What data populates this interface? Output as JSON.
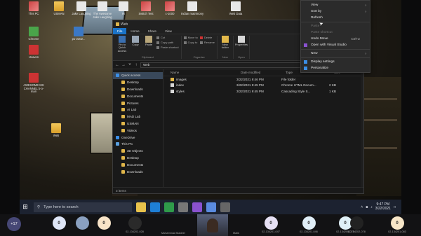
{
  "desktop": {
    "icons": [
      {
        "label": "This PC",
        "kind": "app"
      },
      {
        "label": "USMAN",
        "kind": "folder"
      },
      {
        "label": "Jake Laughing",
        "kind": "doc"
      },
      {
        "label": "The Awesome Jake Laughing",
        "kind": "doc"
      },
      {
        "label": "Hi",
        "kind": "doc"
      },
      {
        "label": "Switch Test",
        "kind": "app"
      },
      {
        "label": "c-1000",
        "kind": "app"
      },
      {
        "label": "Indian matrimony",
        "kind": "doc"
      },
      {
        "label": "Web Data",
        "kind": "doc"
      },
      {
        "label": "Chrome",
        "kind": "grn"
      },
      {
        "label": "Uxaves",
        "kind": "red"
      },
      {
        "label": "p1-2202...",
        "kind": "star"
      },
      {
        "label": "AWESOME MS CHANNEL b-o-man",
        "kind": "red"
      },
      {
        "label": "Web",
        "kind": "folder"
      }
    ]
  },
  "explorer": {
    "title": "Web",
    "tabs": [
      "File",
      "Home",
      "Share",
      "View"
    ],
    "ribbon": {
      "clipboard": {
        "name": "Clipboard",
        "pin": "Pin to Quick access",
        "copy": "Copy",
        "paste": "Paste",
        "cut": "Cut",
        "copy_path": "Copy path",
        "paste_shortcut": "Paste shortcut"
      },
      "organize": {
        "name": "Organize",
        "move_to": "Move to",
        "copy_to": "Copy to",
        "delete": "Delete",
        "rename": "Rename"
      },
      "new": {
        "name": "New",
        "new_folder": "New folder"
      },
      "open": {
        "name": "Open",
        "properties": "Properties"
      }
    },
    "address": "Web",
    "nav": [
      {
        "label": "Quick access",
        "selected": true
      },
      {
        "label": "Desktop"
      },
      {
        "label": "Downloads"
      },
      {
        "label": "Documents"
      },
      {
        "label": "Pictures"
      },
      {
        "label": "AI Lab"
      },
      {
        "label": "MAD Lab"
      },
      {
        "label": "USMAN"
      },
      {
        "label": "Videos"
      },
      {
        "label": "OneDrive"
      },
      {
        "label": "This PC"
      },
      {
        "label": "3D Objects"
      },
      {
        "label": "Desktop"
      },
      {
        "label": "Documents"
      },
      {
        "label": "Downloads"
      }
    ],
    "columns": {
      "name": "Name",
      "date": "Date modified",
      "type": "Type",
      "size": "Size"
    },
    "files": [
      {
        "name": "images",
        "date": "3/22/2021 9:46 PM",
        "type": "File folder",
        "size": "",
        "kind": "folder"
      },
      {
        "name": "index",
        "date": "3/22/2021 9:45 PM",
        "type": "Chrome HTML Docum...",
        "size": "2 KB",
        "kind": "html"
      },
      {
        "name": "styles",
        "date": "3/22/2021 9:45 PM",
        "type": "Cascading Style S...",
        "size": "1 KB",
        "kind": "css"
      }
    ],
    "status": "3 items"
  },
  "context_menu": {
    "items": [
      {
        "label": "View",
        "arrow": true
      },
      {
        "label": "Sort by",
        "arrow": true
      },
      {
        "label": "Refresh"
      },
      {
        "sep": true
      },
      {
        "label": "Paste",
        "disabled": true
      },
      {
        "label": "Paste shortcut",
        "disabled": true
      },
      {
        "label": "Undo Move",
        "shortcut": "Ctrl+Z"
      },
      {
        "label": "Open with Visual Studio"
      },
      {
        "sep": true
      },
      {
        "label": "New",
        "arrow": true
      },
      {
        "sep": true
      },
      {
        "label": "Display settings"
      },
      {
        "label": "Personalize"
      }
    ]
  },
  "taskbar": {
    "search_placeholder": "Type here to search",
    "time": "9:47 PM",
    "date": "3/22/2021",
    "apps": [
      "#e8c24c",
      "#1e7fd6",
      "#2f9a4a",
      "#777777",
      "#8a52d0",
      "#5a8be0",
      "#666666"
    ]
  },
  "meeting": {
    "more_count": "+17",
    "participants": [
      {
        "name": "",
        "initial": "0",
        "color": "#dfe6f7"
      },
      {
        "name": "",
        "initial": "",
        "color": "#8aa0c0"
      },
      {
        "name": "",
        "initial": "0",
        "color": "#f7e3c7"
      },
      {
        "name": "02-134202-028",
        "initial": "",
        "color": "#2a2a2a"
      },
      {
        "name": "Muhammad Madeel",
        "initial": "",
        "color": "#666666"
      },
      {
        "name": "Malik",
        "initial": "",
        "color": "#555555"
      },
      {
        "name": "02-134201-047",
        "initial": "0",
        "color": "#e6e0f4"
      },
      {
        "name": "02-134201-046",
        "initial": "0",
        "color": "#e0eef7"
      },
      {
        "name": "02-134201-075",
        "initial": "0",
        "color": "#dff0f7"
      },
      {
        "name": "02-134202-078",
        "initial": "",
        "color": "#222222"
      },
      {
        "name": "02-134201-083",
        "initial": "0",
        "color": "#f7e6c8"
      }
    ]
  }
}
